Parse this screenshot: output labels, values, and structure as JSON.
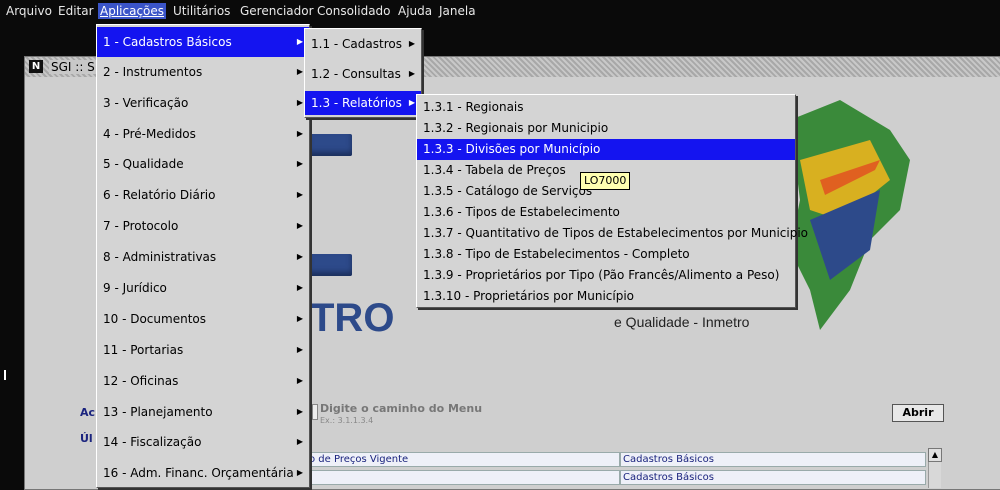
{
  "menubar": [
    "Arquivo",
    "Editar",
    "Aplicações",
    "Utilitários",
    "Gerenciador",
    "Consolidado",
    "Ajuda",
    "Janela"
  ],
  "window": {
    "title": "SGI :: S"
  },
  "logo": {
    "text": "TRO",
    "subtitle": "e Qualidade - Inmetro"
  },
  "bottom": {
    "ac_label": "Ac",
    "ul_label": "Úl",
    "path_hint": "Digite o caminho do Menu",
    "path_example": "Ex.: 3.1.1.3.4",
    "open_button": "Abrir",
    "rows": [
      {
        "col1": "o de Preços Vigente",
        "col2": "Cadastros Básicos"
      },
      {
        "col1": "",
        "col2": "Cadastros Básicos"
      }
    ]
  },
  "menu1": [
    "1 - Cadastros Básicos",
    "2 - Instrumentos",
    "3 - Verificação",
    "4 - Pré-Medidos",
    "5 - Qualidade",
    "6 - Relatório Diário",
    "7 - Protocolo",
    "8 - Administrativas",
    "9 - Jurídico",
    "10 - Documentos",
    "11 - Portarias",
    "12 - Oficinas",
    "13 - Planejamento",
    "14 - Fiscalização",
    "16 - Adm. Financ. Orçamentária"
  ],
  "menu2": [
    "1.1 - Cadastros",
    "1.2 - Consultas",
    "1.3 - Relatórios"
  ],
  "menu3": [
    "1.3.1 - Regionais",
    "1.3.2 - Regionais por Municipio",
    "1.3.3 - Divisões por Município",
    "1.3.4 - Tabela de Preços",
    "1.3.5 - Catálogo de Serviços",
    "1.3.6 - Tipos de Estabelecimento",
    "1.3.7 - Quantitativo de Tipos de Estabelecimentos por Municipio",
    "1.3.8 - Tipo de Estabelecimentos - Completo",
    "1.3.9 - Proprietários por Tipo (Pão Francês/Alimento a Peso)",
    "1.3.10 - Proprietários por Município"
  ],
  "tooltip": "LO7000",
  "arrow_glyph": "▶"
}
